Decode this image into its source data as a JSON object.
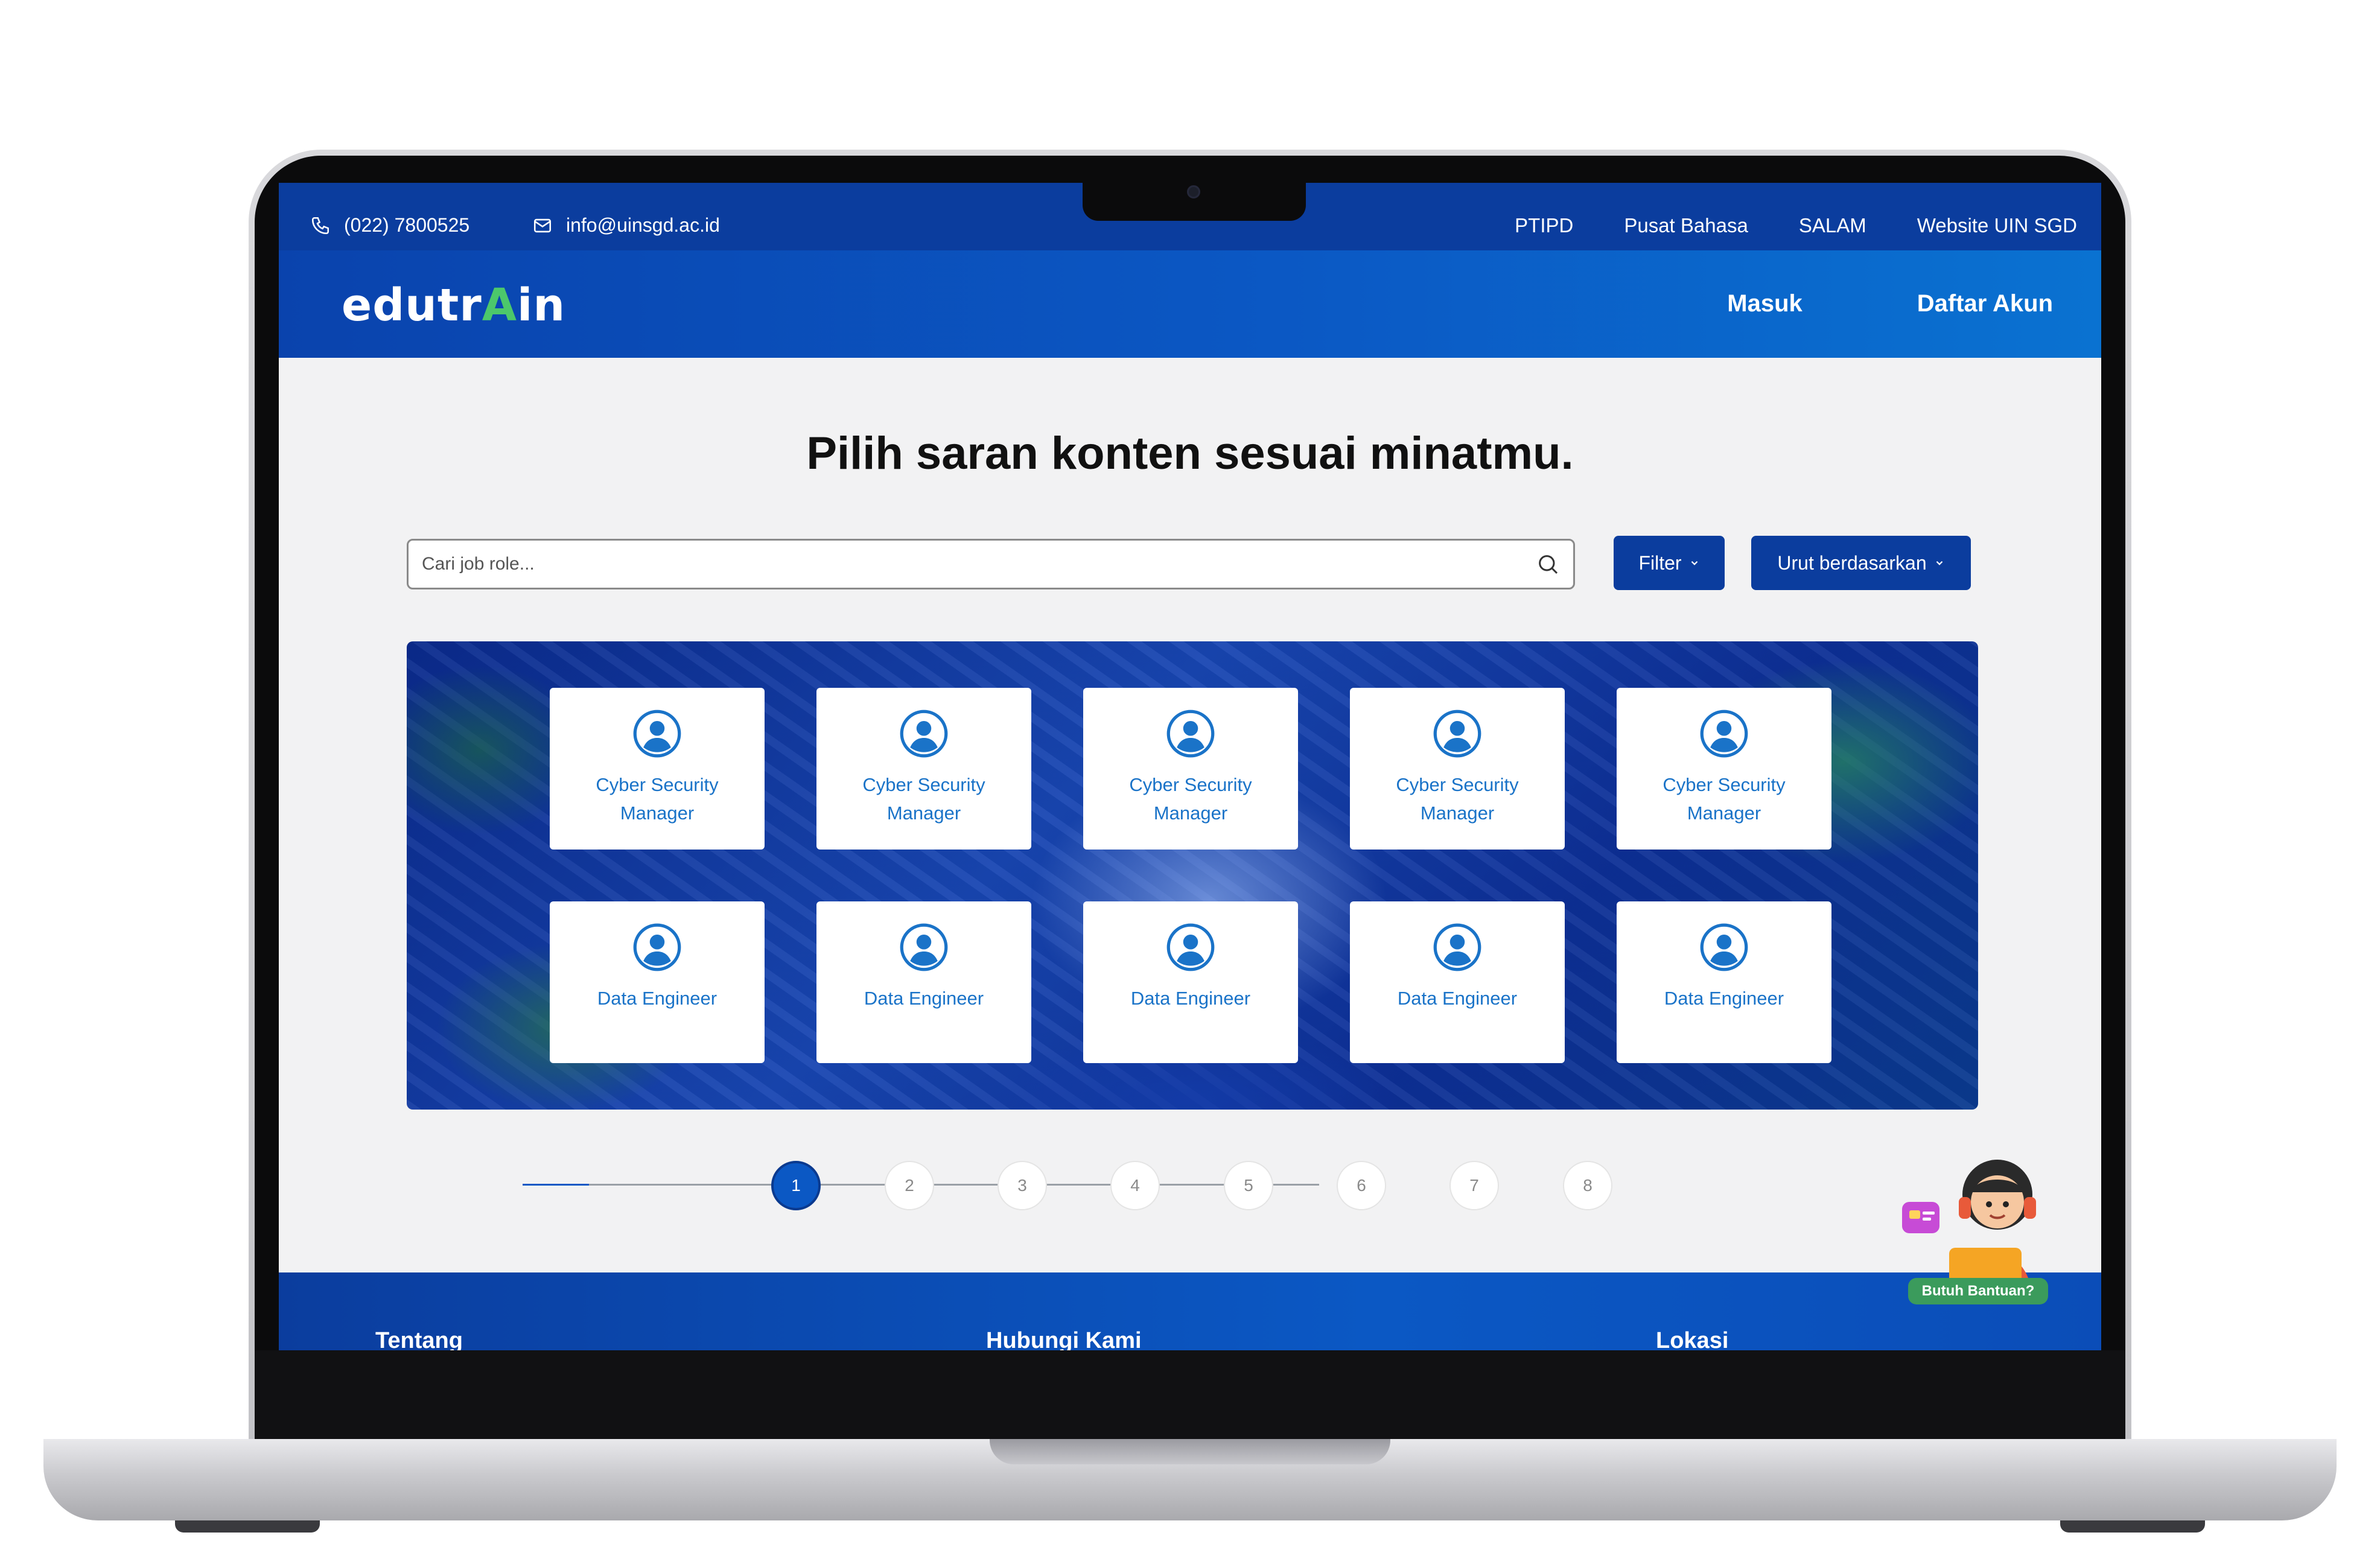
{
  "topbar": {
    "phone": "(022) 7800525",
    "email": "info@uinsgd.ac.id",
    "links": [
      "PTIPD",
      "Pusat Bahasa",
      "SALAM",
      "Website UIN SGD"
    ]
  },
  "header": {
    "logo_prefix": "edutr",
    "logo_rocket": "A",
    "logo_suffix": "in",
    "nav": [
      "Masuk",
      "Daftar Akun"
    ]
  },
  "main": {
    "headline": "Pilih saran konten sesuai minatmu.",
    "search_placeholder": "Cari job role...",
    "filter_label": "Filter",
    "sort_label": "Urut berdasarkan"
  },
  "cards": {
    "row1": [
      "Cyber Security Manager",
      "Cyber Security Manager",
      "Cyber Security Manager",
      "Cyber Security Manager",
      "Cyber Security Manager"
    ],
    "row2": [
      "Data Engineer",
      "Data Engineer",
      "Data Engineer",
      "Data Engineer",
      "Data Engineer"
    ]
  },
  "pagination": {
    "pages": [
      "1",
      "2",
      "3",
      "4",
      "5",
      "6",
      "7",
      "8"
    ],
    "current": "1"
  },
  "footer": {
    "headings": [
      "Tentang",
      "Hubungi Kami",
      "Lokasi"
    ]
  },
  "help": {
    "label": "Butuh Bantuan?"
  },
  "icons": {
    "phone": "phone-icon",
    "email": "mail-icon",
    "search": "search-icon",
    "chevron": "chevron-down-icon",
    "card": "user-circle-icon"
  },
  "colors": {
    "brand_blue": "#0b3d9e",
    "accent_blue": "#0b58c4",
    "card_text": "#1a73c8",
    "help_green": "#3b9b5c",
    "rocket_green": "#4cc86b"
  }
}
